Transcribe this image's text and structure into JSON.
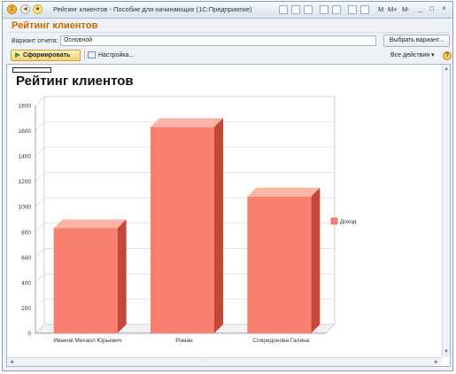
{
  "window": {
    "title": "Рейтинг клиентов - Пособие для начинающих  (1С:Предприятие)",
    "toolbar_text": [
      "M",
      "M+",
      "M-"
    ],
    "controls": [
      "_",
      "□",
      "×"
    ]
  },
  "header": {
    "title": "Рейтинг клиентов"
  },
  "variant": {
    "label": "Вариант отчета:",
    "value": "Основной",
    "choose_button": "Выбрать вариант..."
  },
  "toolbar": {
    "generate": "Сформировать",
    "settings": "Настройка...",
    "all_actions": "Все действия",
    "all_actions_arrow": "▾",
    "help": "?"
  },
  "report": {
    "title": "Рейтинг клиентов"
  },
  "chart_data": {
    "type": "bar",
    "categories": [
      "Иванов Михаил Юрьевич",
      "Роман",
      "Спиридонова Галина"
    ],
    "series": [
      {
        "name": "Доход",
        "values": [
          830,
          1630,
          1080
        ],
        "color": "#f97f6f"
      }
    ],
    "ylim": [
      0,
      1800
    ],
    "yticks": [
      0,
      200,
      400,
      600,
      800,
      1000,
      1200,
      1400,
      1600,
      1800
    ],
    "grid": true,
    "legend": "right",
    "style": "3d"
  },
  "scroll": {
    "up": "▲",
    "down": "▼",
    "left": "◄",
    "right": "►",
    "mid": "·"
  }
}
